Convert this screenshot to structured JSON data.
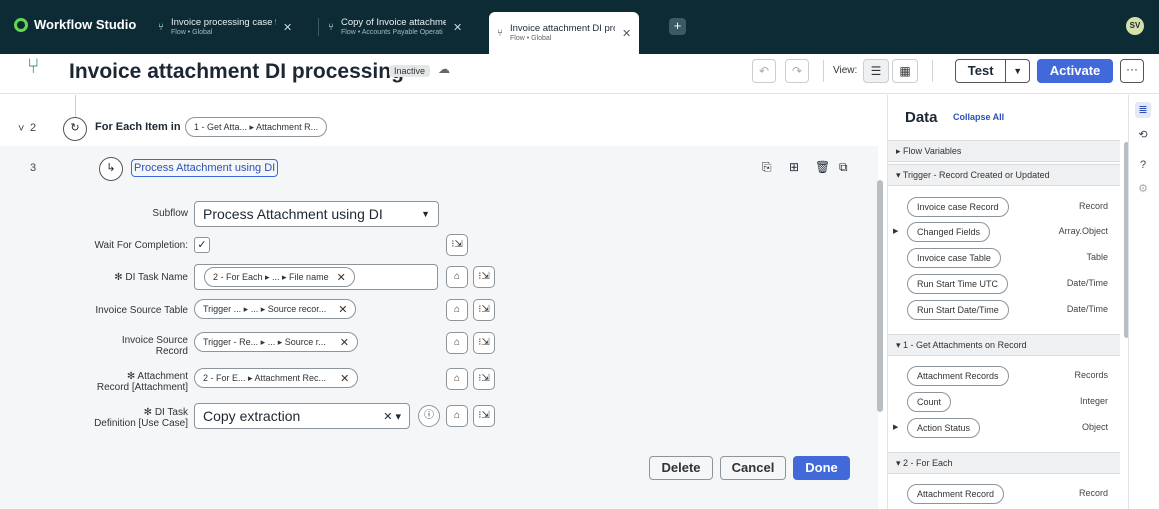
{
  "app": {
    "name": "Workflow Studio"
  },
  "tabs": [
    {
      "title": "Invoice processing case for",
      "subtitle": "Flow • Global"
    },
    {
      "title": "Copy of Invoice attachment",
      "subtitle": "Flow • Accounts Payable Operati"
    },
    {
      "title": "Invoice attachment DI proce",
      "subtitle": "Flow • Global"
    }
  ],
  "user": {
    "initials": "SV"
  },
  "header": {
    "title": "Invoice attachment DI processing",
    "status": "Inactive",
    "view_label": "View:",
    "test_label": "Test",
    "activate_label": "Activate"
  },
  "canvas": {
    "row2": {
      "num": "2",
      "label": "For Each Item in",
      "pill": "1 - Get Atta... ▸ Attachment R..."
    },
    "row3": {
      "num": "3",
      "title": "Process Attachment using DI"
    }
  },
  "form": {
    "subflow_label": "Subflow",
    "subflow_value": "Process Attachment using DI",
    "wait_label": "Wait For Completion:",
    "wait_checked": true,
    "di_task_name_label": "✻ DI Task Name",
    "di_task_name_pill": "2 - For Each ▸ ... ▸ File name",
    "source_table_label": "Invoice Source Table",
    "source_table_pill": "Trigger ... ▸ ... ▸ Source recor...",
    "source_record_label1": "Invoice Source",
    "source_record_label2": "Record",
    "source_record_pill": "Trigger - Re... ▸ ... ▸ Source r...",
    "attachment_label1": "✻ Attachment",
    "attachment_label2": "Record [Attachment]",
    "attachment_pill": "2 - For E... ▸ Attachment Rec...",
    "di_def_label1": "✻ DI Task",
    "di_def_label2": "Definition [Use Case]",
    "di_def_value": "Copy extraction",
    "delete_label": "Delete",
    "cancel_label": "Cancel",
    "done_label": "Done"
  },
  "data_panel": {
    "title": "Data",
    "collapse_all": "Collapse All",
    "sections": [
      {
        "label": "▸ Flow Variables"
      },
      {
        "label": "▾ Trigger - Record Created or Updated"
      },
      {
        "label": "▾ 1 - Get Attachments on Record"
      },
      {
        "label": "▾ 2 - For Each"
      }
    ],
    "items": [
      {
        "name": "Invoice case Record",
        "type": "Record"
      },
      {
        "name": "Changed Fields",
        "type": "Array.Object"
      },
      {
        "name": "Invoice case Table",
        "type": "Table"
      },
      {
        "name": "Run Start Time UTC",
        "type": "Date/Time"
      },
      {
        "name": "Run Start Date/Time",
        "type": "Date/Time"
      },
      {
        "name": "Attachment Records",
        "type": "Records"
      },
      {
        "name": "Count",
        "type": "Integer"
      },
      {
        "name": "Action Status",
        "type": "Object"
      },
      {
        "name": "Attachment Record",
        "type": "Record"
      }
    ]
  },
  "colors": {
    "topbar": "#0d2b35",
    "accent": "#4169d9",
    "brand_green": "#62d84e"
  }
}
